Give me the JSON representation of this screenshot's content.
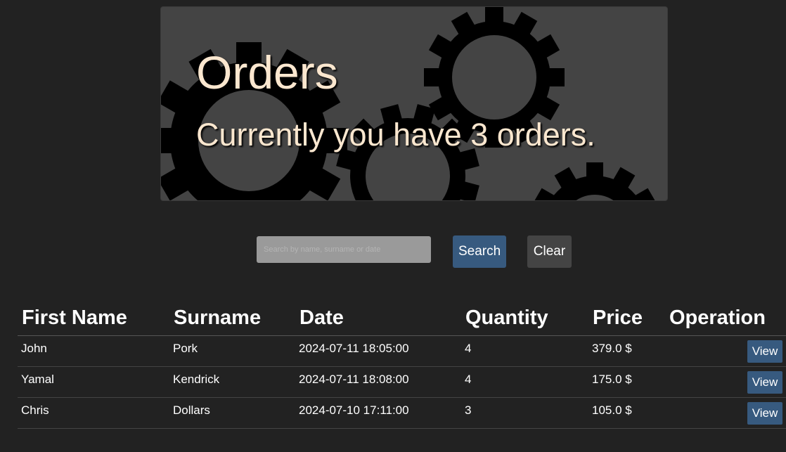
{
  "hero": {
    "title": "Orders",
    "subtitle": "Currently you have 3 orders."
  },
  "search": {
    "placeholder": "Search by name, surname or date",
    "value": "",
    "search_label": "Search",
    "clear_label": "Clear"
  },
  "table": {
    "headers": [
      "First Name",
      "Surname",
      "Date",
      "Quantity",
      "Price",
      "Operation"
    ],
    "rows": [
      {
        "first": "John",
        "surname": "Pork",
        "date": "2024-07-11 18:05:00",
        "quantity": "4",
        "price": "379.0 $",
        "action": "View"
      },
      {
        "first": "Yamal",
        "surname": "Kendrick",
        "date": "2024-07-11 18:08:00",
        "quantity": "4",
        "price": "175.0 $",
        "action": "View"
      },
      {
        "first": "Chris",
        "surname": "Dollars",
        "date": "2024-07-10 17:11:00",
        "quantity": "3",
        "price": "105.0 $",
        "action": "View"
      }
    ]
  },
  "colors": {
    "background": "#222222",
    "hero_background": "#444444",
    "primary_button": "#375a7f",
    "secondary_button": "#444444",
    "hero_text": "#fbe7cf"
  },
  "icons": {
    "hero_background": "gears-icon"
  }
}
